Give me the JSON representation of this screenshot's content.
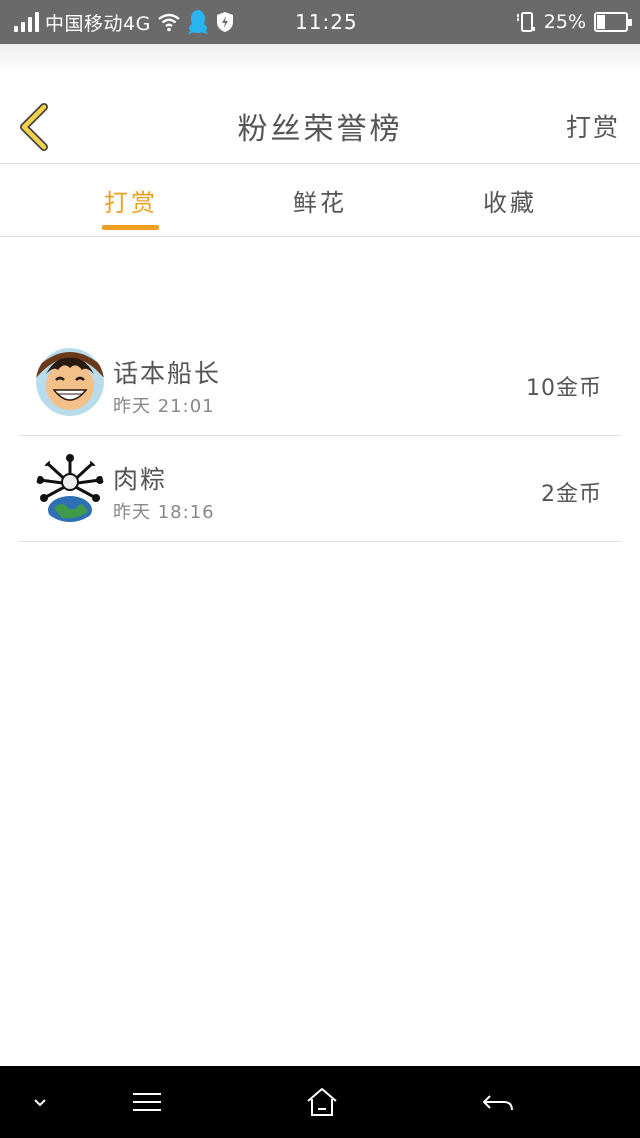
{
  "status_bar": {
    "carrier": "中国移动4G",
    "time": "11:25",
    "battery_percent": "25%",
    "battery_level": 0.25
  },
  "header": {
    "title": "粉丝荣誉榜",
    "action_label": "打赏"
  },
  "tabs": [
    {
      "label": "打赏",
      "active": true
    },
    {
      "label": "鲜花",
      "active": false
    },
    {
      "label": "收藏",
      "active": false
    }
  ],
  "list": [
    {
      "name": "话本船长",
      "time": "昨天 21:01",
      "amount": "10金币",
      "avatar": "luffy-avatar"
    },
    {
      "name": "肉粽",
      "time": "昨天 18:16",
      "amount": "2金币",
      "avatar": "globe-avatar"
    }
  ],
  "colors": {
    "accent": "#f0a020",
    "back_arrow": "#f5d14a",
    "text": "#555555",
    "status_bar": "#6a6a6a"
  },
  "nav_icons": [
    "chevron-down-icon",
    "menu-icon",
    "home-icon",
    "back-icon"
  ]
}
